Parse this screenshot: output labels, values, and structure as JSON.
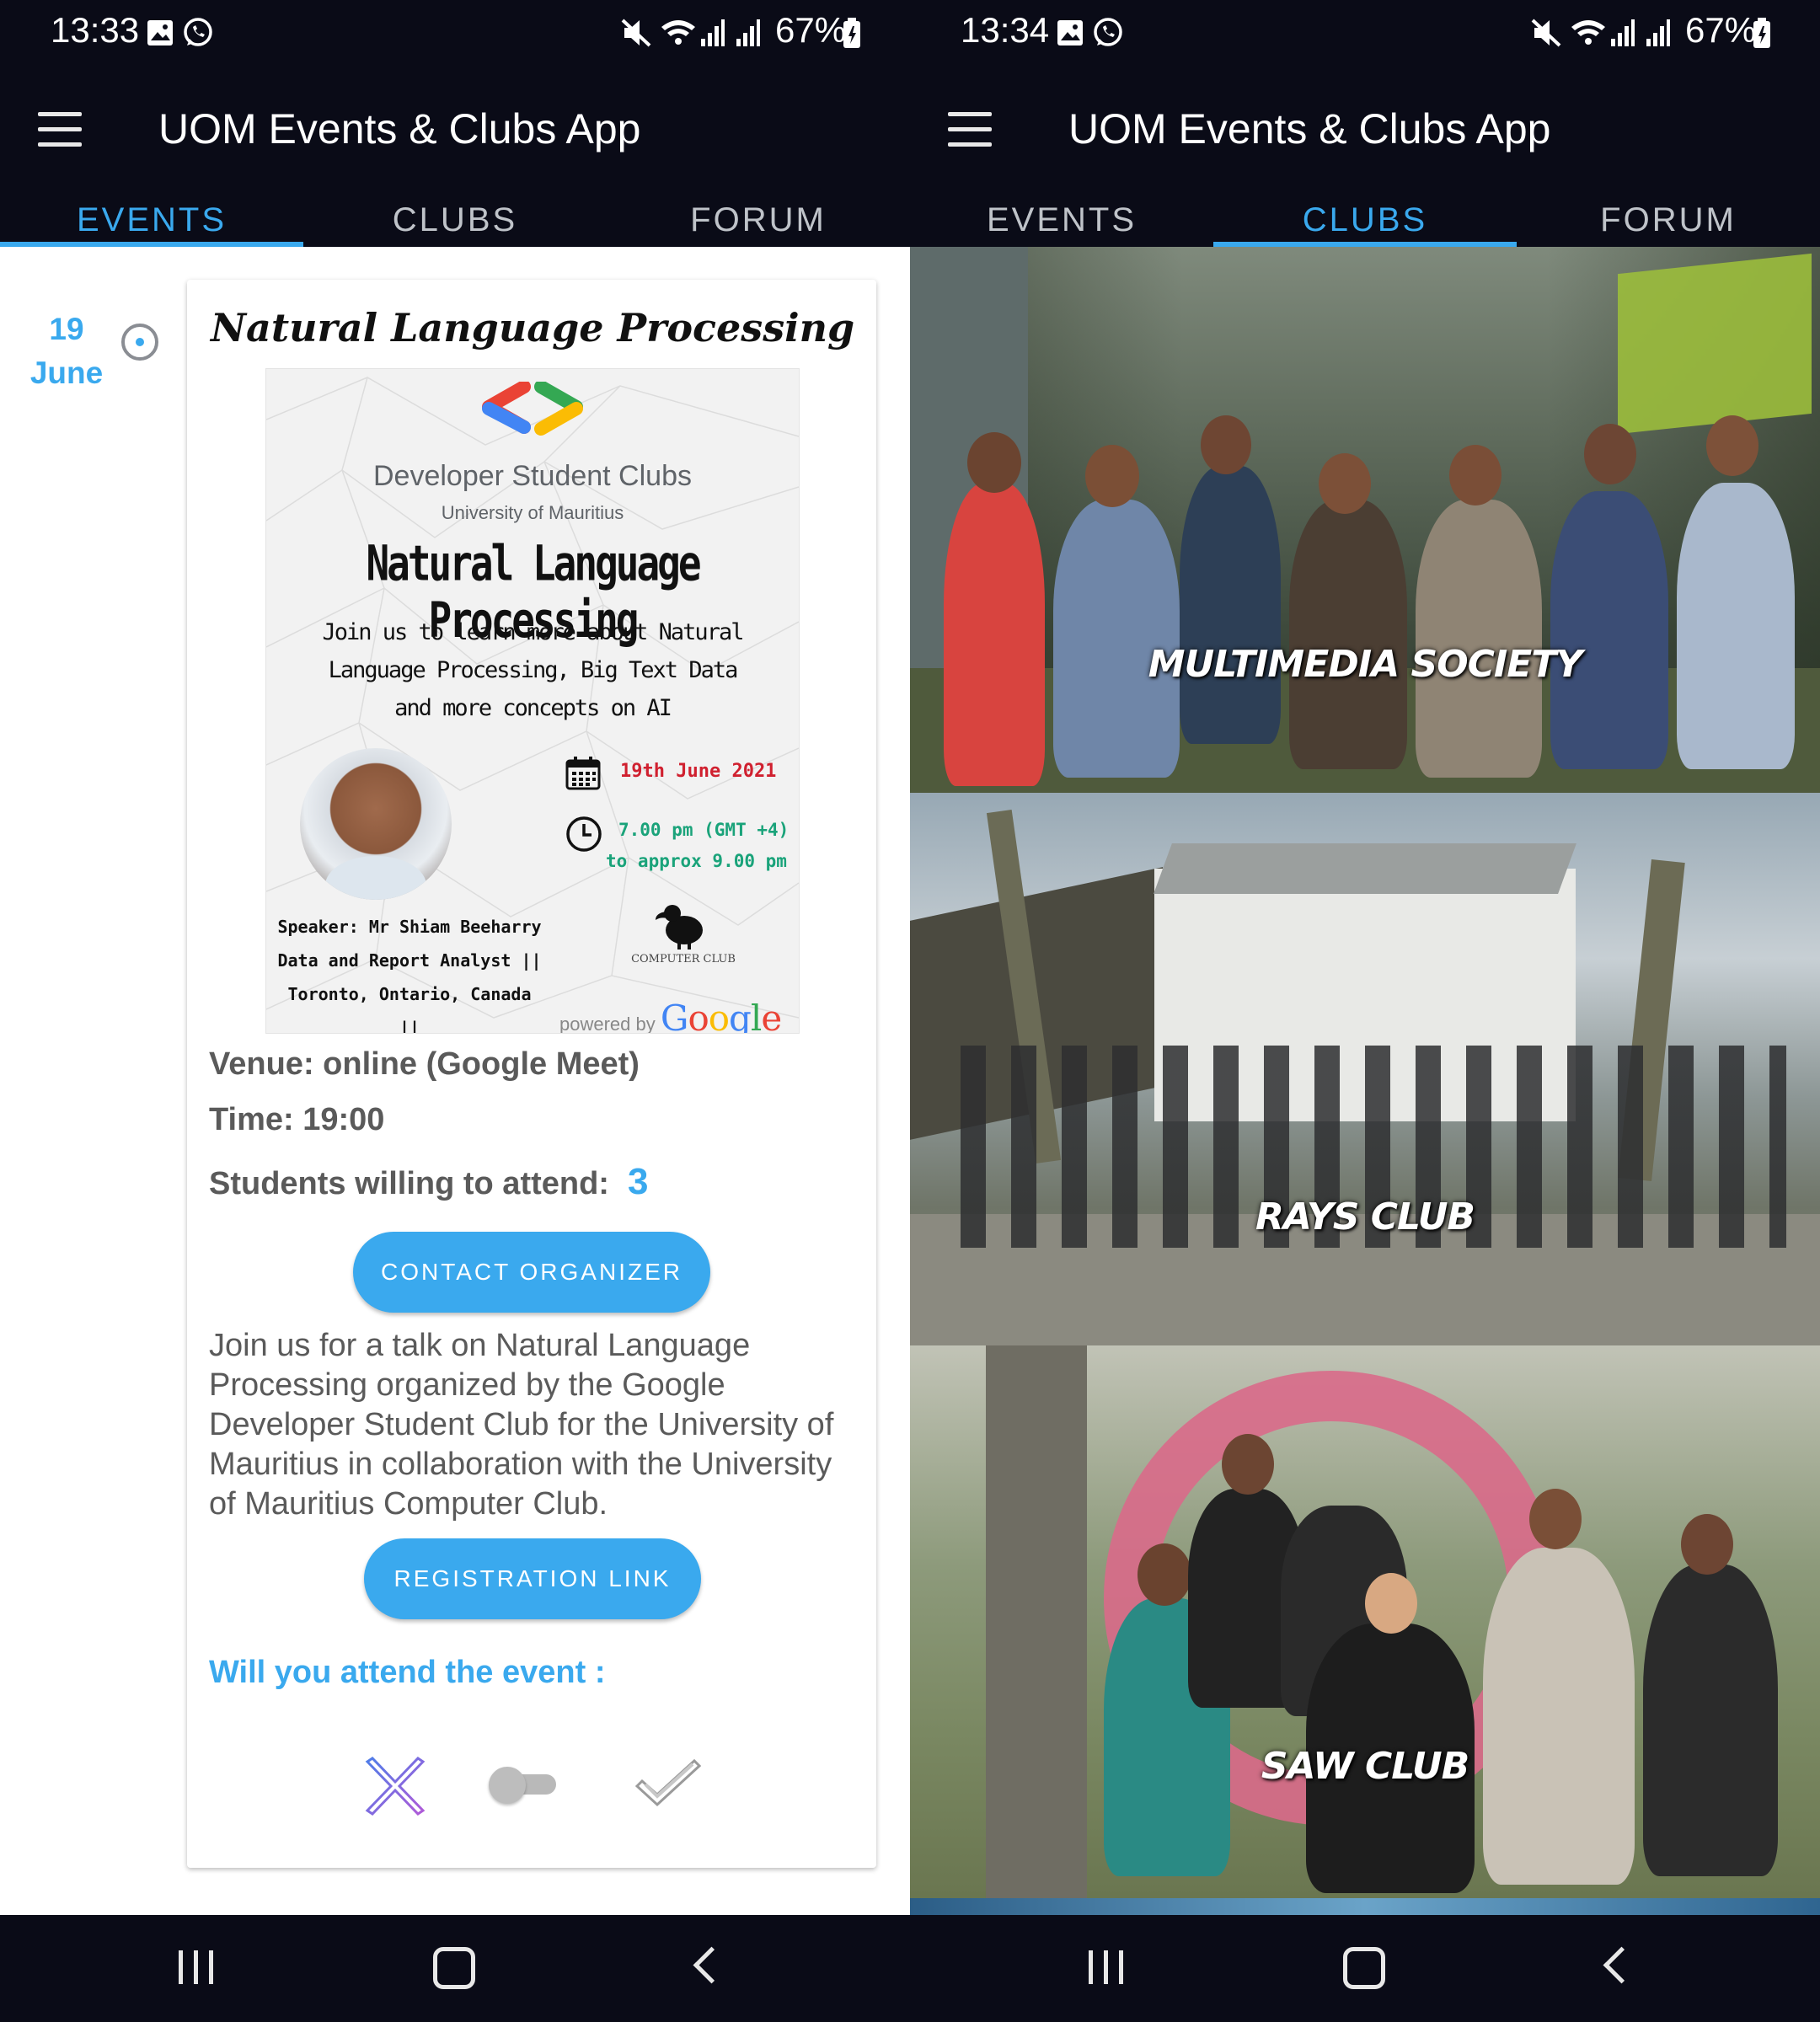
{
  "left_screen": {
    "status": {
      "time": "13:33",
      "battery": "67%"
    },
    "app_title": "UOM Events & Clubs App",
    "tabs": [
      {
        "label": "EVENTS",
        "active": true
      },
      {
        "label": "CLUBS",
        "active": false
      },
      {
        "label": "FORUM",
        "active": false
      }
    ],
    "event": {
      "day": "19",
      "month": "June",
      "title": "Natural Language Processing",
      "poster": {
        "org": "Developer Student Clubs",
        "university": "University of Mauritius",
        "title": "Natural Language Processing",
        "description": "Join us to learn more about Natural Language Processing, Big Text Data and more concepts on AI",
        "date": "19th June 2021",
        "time_line1": "7.00 pm (GMT +4)",
        "time_line2": "to approx 9.00 pm",
        "speaker_line1": "Speaker: Mr Shiam Beeharry",
        "speaker_line2": "Data and Report Analyst ||",
        "speaker_line3": "Toronto, Ontario, Canada ||",
        "club_logo_text": "COMPUTER CLUB",
        "powered_by": "powered by",
        "google": "Google"
      },
      "venue": "Venue: online (Google Meet)",
      "time": "Time: 19:00",
      "attend_label": "Students willing to attend:",
      "attend_count": "3",
      "contact_button": "CONTACT ORGANIZER",
      "description": "Join us for a talk on Natural Language Processing organized by the Google Developer Student Club for the University of Mauritius in collaboration with the University of Mauritius Computer Club.",
      "registration_button": "REGISTRATION LINK",
      "attend_question": "Will you attend the event :",
      "toggle_on": false
    }
  },
  "right_screen": {
    "status": {
      "time": "13:34",
      "battery": "67%"
    },
    "app_title": "UOM Events & Clubs App",
    "tabs": [
      {
        "label": "EVENTS",
        "active": false
      },
      {
        "label": "CLUBS",
        "active": true
      },
      {
        "label": "FORUM",
        "active": false
      }
    ],
    "clubs": [
      {
        "name": "MULTIMEDIA SOCIETY"
      },
      {
        "name": "RAYS CLUB"
      },
      {
        "name": "SAW CLUB"
      }
    ]
  },
  "colors": {
    "accent": "#3aa9ee",
    "bar_background": "#0a0b17",
    "poster_date_red": "#d0202f",
    "poster_time_green": "#1aa37a"
  },
  "icons": {
    "status_left": [
      "gallery-icon",
      "whatsapp-icon"
    ],
    "status_right": [
      "mute-icon",
      "wifi-icon",
      "signal-icon",
      "signal-icon",
      "battery-icon"
    ],
    "navbar": [
      "recent-apps-icon",
      "home-icon",
      "back-icon"
    ]
  }
}
